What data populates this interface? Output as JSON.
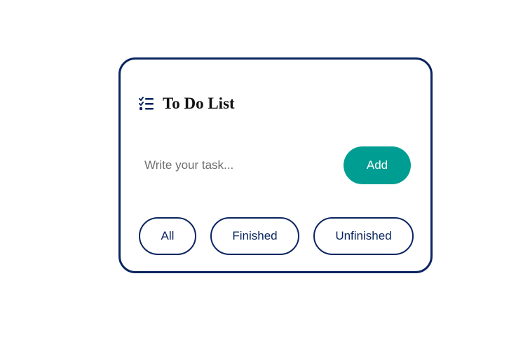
{
  "card": {
    "title": "To Do List",
    "title_icon": "checklist-icon"
  },
  "task": {
    "placeholder": "Write your task...",
    "value": "",
    "add_label": "Add"
  },
  "filters": {
    "all_label": "All",
    "finished_label": "Finished",
    "unfinished_label": "Unfinished"
  },
  "colors": {
    "border": "#0b2560",
    "accent": "#009e92",
    "background": "#ffffff"
  }
}
